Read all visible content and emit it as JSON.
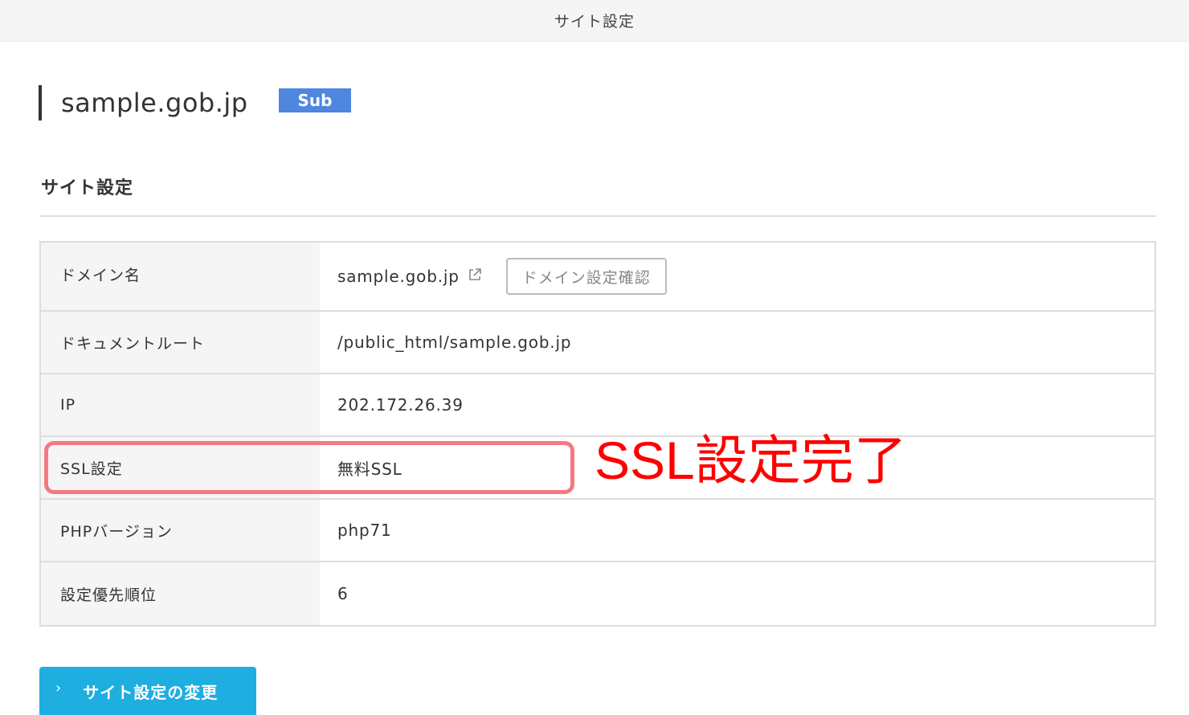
{
  "topbar": {
    "title": "サイト設定"
  },
  "domain": {
    "name": "sample.gob.jp",
    "badge": "Sub",
    "badge_color": "#4f86e0"
  },
  "section": {
    "title": "サイト設定"
  },
  "table": {
    "rows": [
      {
        "label": "ドメイン名",
        "value": "sample.gob.jp"
      },
      {
        "label": "ドキュメントルート",
        "value": "/public_html/sample.gob.jp"
      },
      {
        "label": "IP",
        "value": "202.172.26.39"
      },
      {
        "label": "SSL設定",
        "value": "無料SSL"
      },
      {
        "label": "PHPバージョン",
        "value": "php71"
      },
      {
        "label": "設定優先順位",
        "value": "6"
      }
    ],
    "domain_check_button": "ドメイン設定確認",
    "external_link_icon": "external-link-icon"
  },
  "annotation": {
    "text": "SSL設定完了",
    "color": "#ff0000",
    "highlight_color": "#f47a80"
  },
  "actions": {
    "change_button": "サイト設定の変更",
    "change_button_icon": "chevron-right-icon",
    "button_color": "#1eaee0"
  }
}
